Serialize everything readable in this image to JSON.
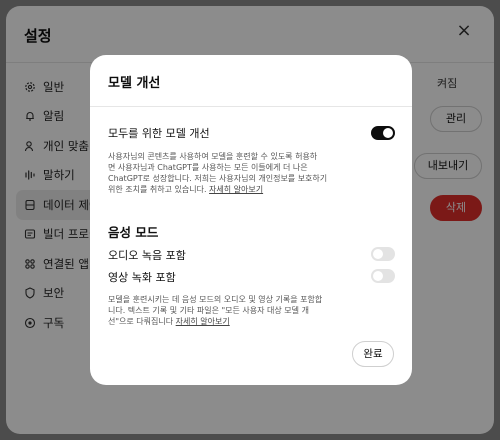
{
  "settings": {
    "title": "설정",
    "close_glyph": "×",
    "nav": [
      {
        "label": "일반",
        "icon": "gear-icon"
      },
      {
        "label": "알림",
        "icon": "bell-icon"
      },
      {
        "label": "개인 맞춤",
        "icon": "person-icon"
      },
      {
        "label": "말하기",
        "icon": "waveform-icon"
      },
      {
        "label": "데이터 제어",
        "icon": "database-icon",
        "active": true
      },
      {
        "label": "빌더 프로필",
        "icon": "id-card-icon"
      },
      {
        "label": "연결된 앱",
        "icon": "grid-icon"
      },
      {
        "label": "보안",
        "icon": "shield-icon"
      },
      {
        "label": "구독",
        "icon": "subscription-icon"
      }
    ],
    "right": {
      "toggle_state_text": "켜짐",
      "manage_label": "관리",
      "export_label": "내보내기",
      "delete_label": "삭제"
    },
    "colors": {
      "danger": "#e02e2a",
      "active_nav_bg": "#ececec"
    }
  },
  "modal": {
    "title": "모델 개선",
    "improve": {
      "label": "모두를 위한 모델 개선",
      "enabled": true,
      "desc_line1": "사용자님의 콘텐츠를 사용하여 모델을 훈련할 수 있도록 허용하",
      "desc_line2": "면 사용자님과 ChatGPT를 사용하는 모든 이들에게 더 나은",
      "desc_line3": "ChatGPT로 성장합니다. 저희는 사용자님의 개인정보를 보호하기",
      "desc_line4": "위한 조치를 취하고 있습니다.",
      "link": "자세히 알아보기"
    },
    "voice": {
      "title": "음성 모드",
      "audio_label": "오디오 녹음 포함",
      "audio_enabled": false,
      "video_label": "영상 녹화 포함",
      "video_enabled": false,
      "desc_line1": "모델을 훈련시키는 데 음성 모드의 오디오 및 영상 기록을 포함합",
      "desc_line2": "니다. 텍스트 기록 및 기타 파일은 \"모든 사용자 대상 모델 개",
      "desc_line3": "선\"으로 다뤄집니다",
      "link": "자세히 알아보기"
    },
    "done_label": "완료"
  }
}
